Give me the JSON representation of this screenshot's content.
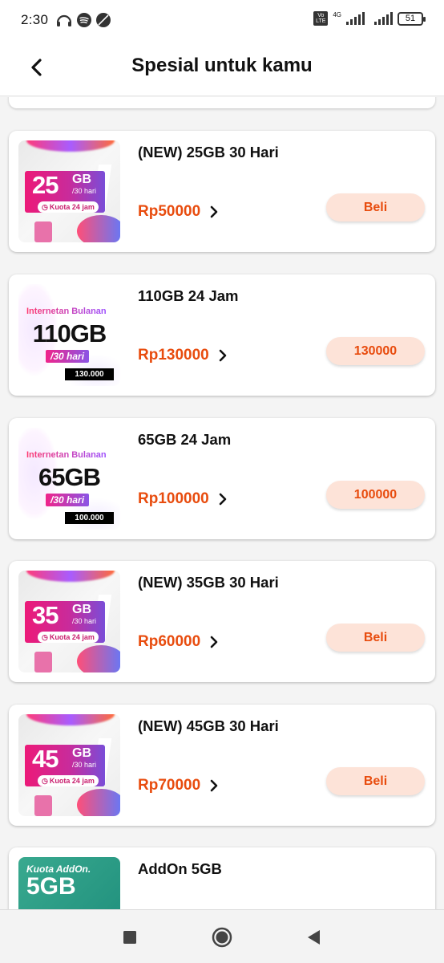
{
  "status_bar": {
    "time": "2:30",
    "network_label": "4G",
    "volte_label": "Vo LTE",
    "battery": "51"
  },
  "header": {
    "title": "Spesial untuk kamu"
  },
  "packages": [
    {
      "name": "(NEW) 25GB 30 Hari",
      "price": "Rp50000",
      "button": "Beli",
      "thumb": {
        "kind": "gb",
        "amount": "25",
        "unit": "GB",
        "period": "/30 hari",
        "kuota": "Kuota 24 jam"
      }
    },
    {
      "name": "110GB 24 Jam",
      "price": "Rp130000",
      "button": "130000",
      "thumb": {
        "kind": "bulanan",
        "title": "Internetan Bulanan",
        "amount": "110GB",
        "period": "/30 hari",
        "price": "130.000"
      }
    },
    {
      "name": "65GB 24 Jam",
      "price": "Rp100000",
      "button": "100000",
      "thumb": {
        "kind": "bulanan",
        "title": "Internetan Bulanan",
        "amount": "65GB",
        "period": "/30 hari",
        "price": "100.000"
      }
    },
    {
      "name": "(NEW) 35GB 30 Hari",
      "price": "Rp60000",
      "button": "Beli",
      "thumb": {
        "kind": "gb",
        "amount": "35",
        "unit": "GB",
        "period": "/30 hari",
        "kuota": "Kuota 24 jam"
      }
    },
    {
      "name": "(NEW) 45GB 30 Hari",
      "price": "Rp70000",
      "button": "Beli",
      "thumb": {
        "kind": "gb",
        "amount": "45",
        "unit": "GB",
        "period": "/30 hari",
        "kuota": "Kuota 24 jam"
      }
    },
    {
      "name": "AddOn 5GB",
      "thumb": {
        "kind": "addon",
        "title": "Kuota AddOn.",
        "amount": "5GB"
      }
    }
  ],
  "colors": {
    "accent": "#e84c0e",
    "button_bg": "#fde3d8"
  },
  "icons": {
    "back": "arrow-left-icon",
    "chevron": "chevron-right-icon",
    "nav_recents": "square-icon",
    "nav_home": "circle-icon",
    "nav_back": "triangle-back-icon"
  }
}
